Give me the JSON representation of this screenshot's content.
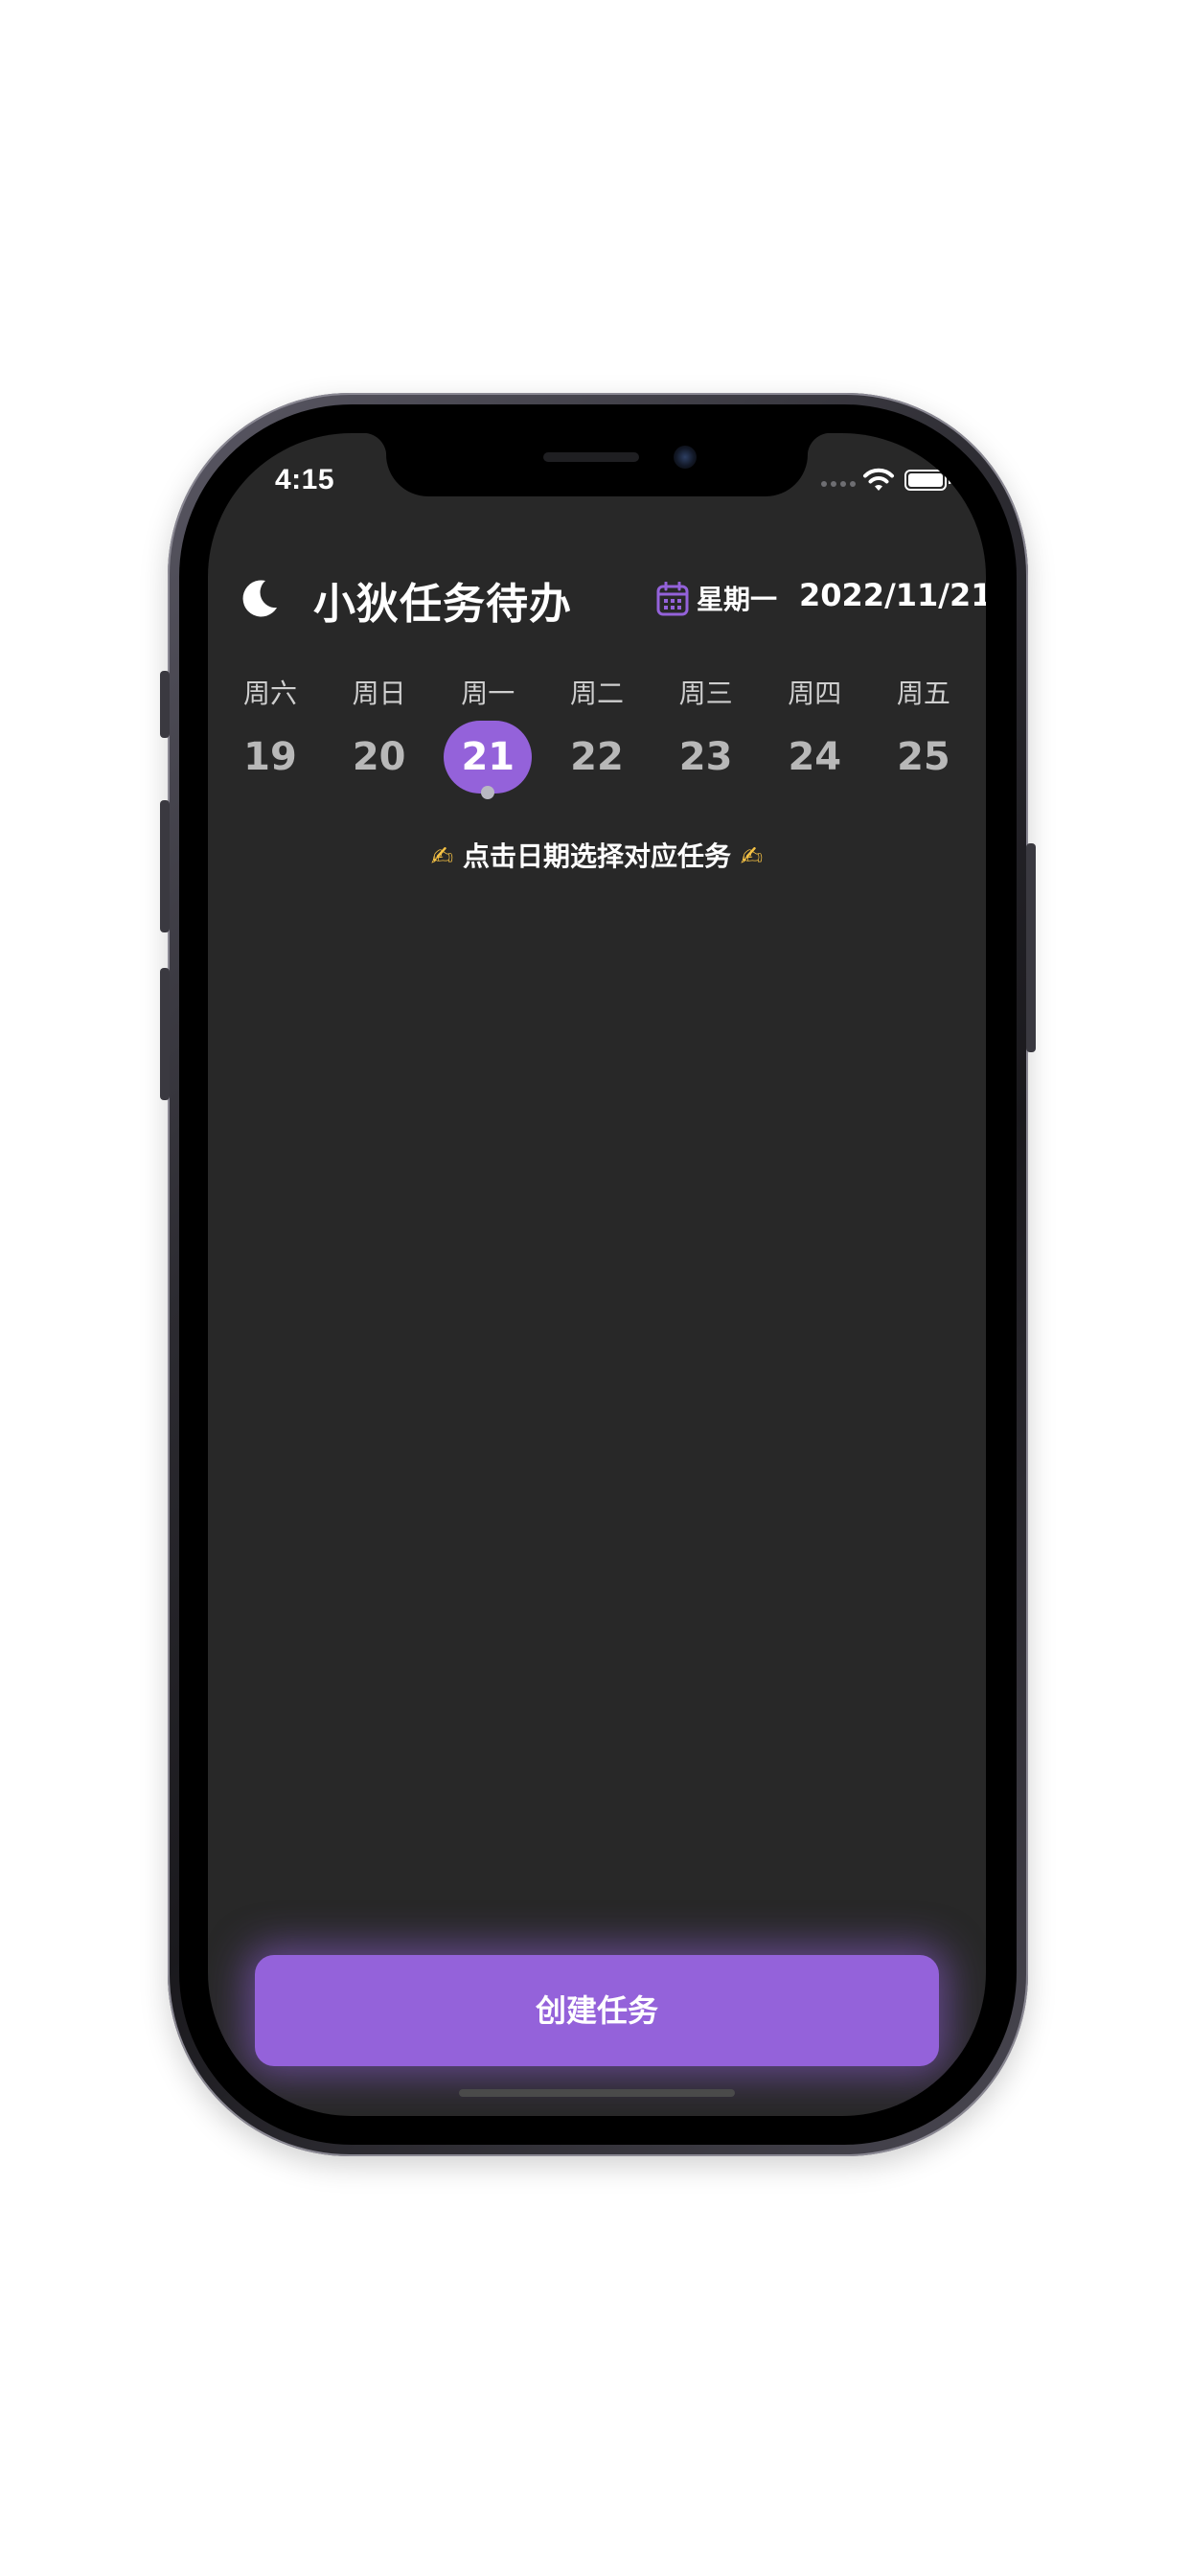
{
  "status_bar": {
    "time": "4:15"
  },
  "header": {
    "app_icon": "moon-icon",
    "title": "小狄任务待办",
    "date_icon": "calendar-icon",
    "weekday": "星期一",
    "date": "2022/11/21"
  },
  "week": {
    "selected_index": 2,
    "days": [
      {
        "name": "周六",
        "number": "19"
      },
      {
        "name": "周日",
        "number": "20"
      },
      {
        "name": "周一",
        "number": "21"
      },
      {
        "name": "周二",
        "number": "22"
      },
      {
        "name": "周三",
        "number": "23"
      },
      {
        "name": "周四",
        "number": "24"
      },
      {
        "name": "周五",
        "number": "25"
      }
    ]
  },
  "hint": {
    "text": "点击日期选择对应任务",
    "emoji": "✍"
  },
  "actions": {
    "create_label": "创建任务"
  },
  "colors": {
    "accent": "#9462da",
    "background": "#282828",
    "text": "#ffffff",
    "muted_text": "#b8b8b8"
  }
}
